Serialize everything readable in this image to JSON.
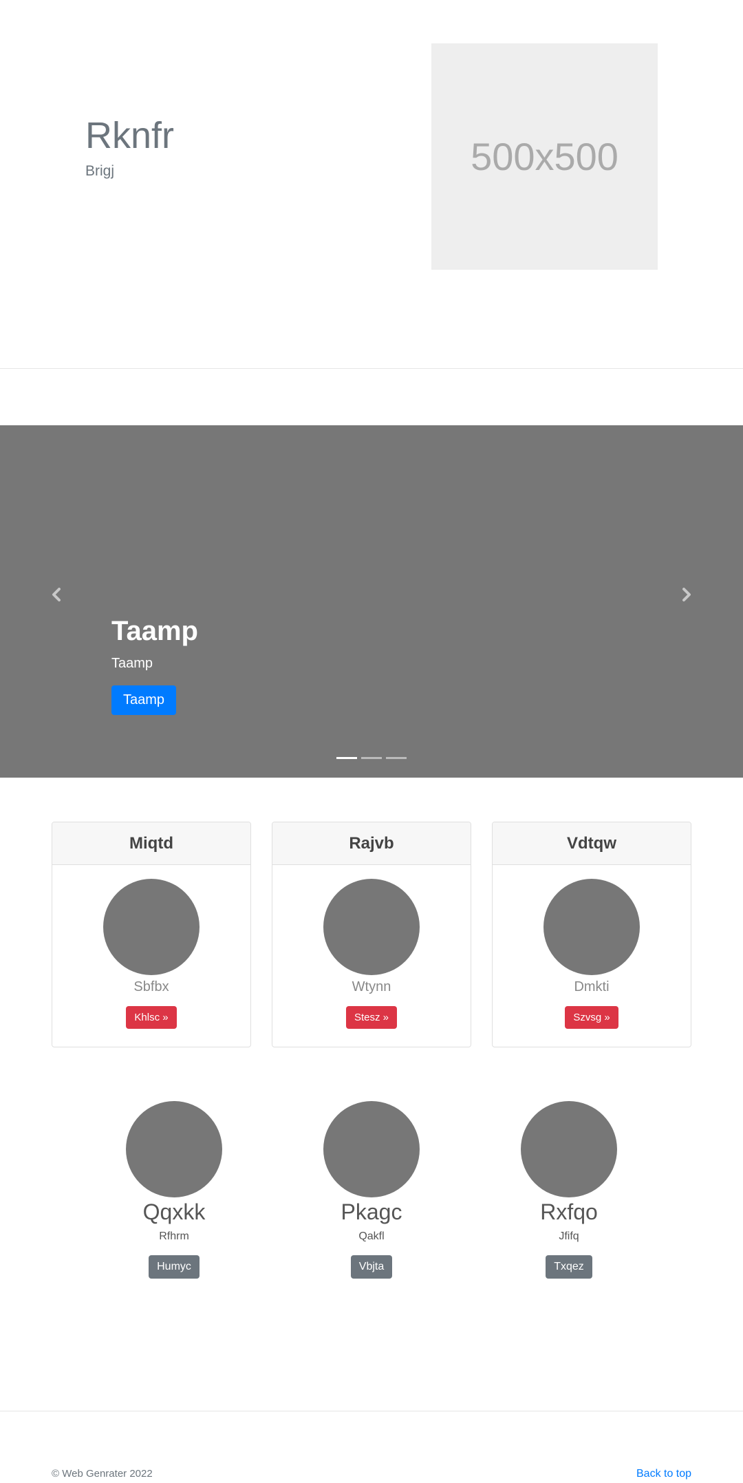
{
  "hero": {
    "title": "Rknfr",
    "subtitle": "Brigj",
    "image_label": "500x500"
  },
  "carousel": {
    "caption_title": "Taamp",
    "caption_text": "Taamp",
    "button_label": "Taamp",
    "prev_icon": "chevron-left-icon",
    "next_icon": "chevron-right-icon",
    "indicator_count": 3,
    "active_indicator": 1
  },
  "cards": [
    {
      "header": "Miqtd",
      "text": "Sbfbx",
      "button": "Khlsc »"
    },
    {
      "header": "Rajvb",
      "text": "Wtynn",
      "button": "Stesz »"
    },
    {
      "header": "Vdtqw",
      "text": "Dmkti",
      "button": "Szvsg »"
    }
  ],
  "team": [
    {
      "name": "Qqxkk",
      "text": "Rfhrm",
      "button": "Humyc"
    },
    {
      "name": "Pkagc",
      "text": "Qakfl",
      "button": "Vbjta"
    },
    {
      "name": "Rxfqo",
      "text": "Jfifq",
      "button": "Txqez"
    }
  ],
  "footer": {
    "copyright": "© Web Genrater 2022",
    "back_to_top": "Back to top"
  },
  "colors": {
    "primary": "#007bff",
    "danger": "#dc3545",
    "secondary": "#6c757d",
    "placeholder_gray": "#777777"
  }
}
